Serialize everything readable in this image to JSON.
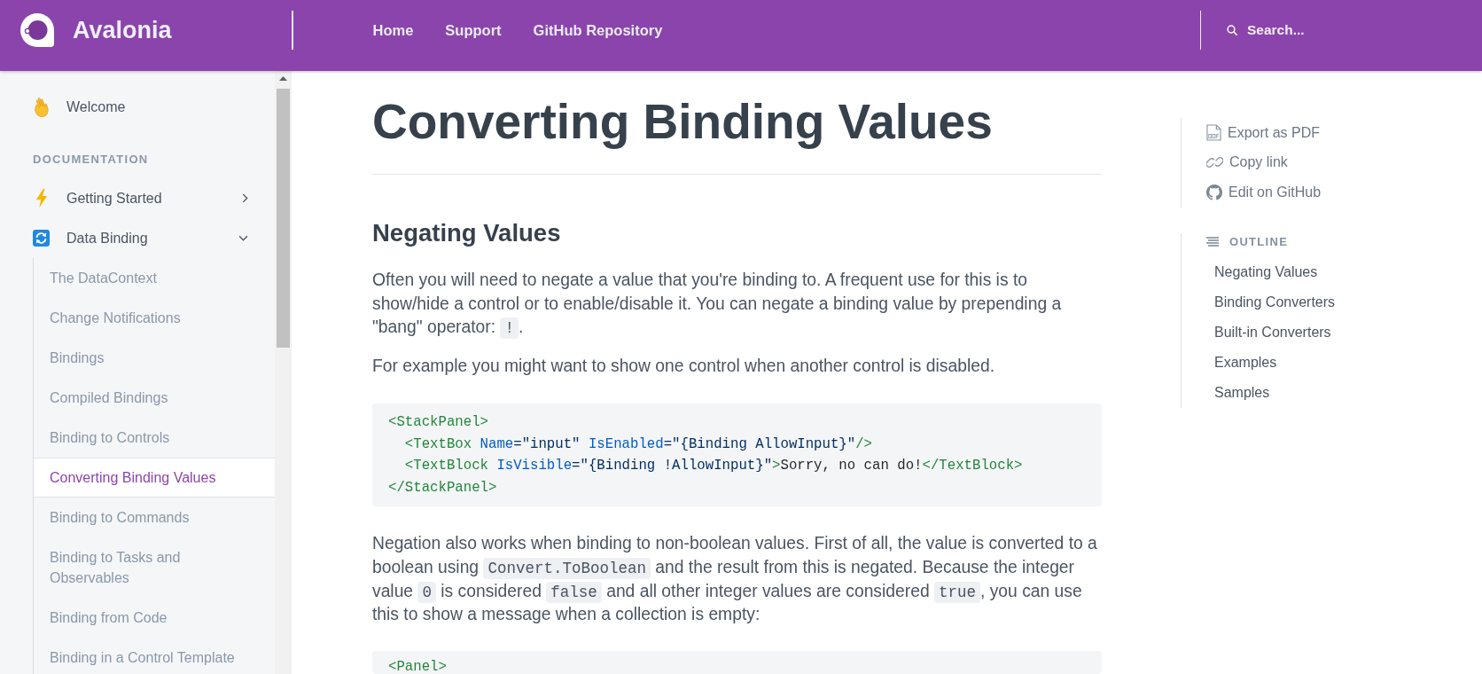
{
  "header": {
    "brand": "Avalonia",
    "nav": [
      "Home",
      "Support",
      "GitHub Repository"
    ],
    "search": {
      "placeholder": "Search..."
    }
  },
  "sidebar": {
    "items": [
      {
        "label": "Welcome",
        "selected": false
      }
    ],
    "sections": [
      {
        "heading": "DOCUMENTATION",
        "items": [
          {
            "label": "Getting Started",
            "selected": false,
            "expanded": false
          },
          {
            "label": "Data Binding",
            "selected": false,
            "expanded": true,
            "children": [
              {
                "label": "The DataContext",
                "selected": false
              },
              {
                "label": "Change Notifications",
                "selected": false
              },
              {
                "label": "Bindings",
                "selected": false
              },
              {
                "label": "Compiled Bindings",
                "selected": false
              },
              {
                "label": "Binding to Controls",
                "selected": false
              },
              {
                "label": "Converting Binding Values",
                "selected": true
              },
              {
                "label": "Binding to Commands",
                "selected": false
              },
              {
                "label": "Binding to Tasks and Observables",
                "selected": false
              },
              {
                "label": "Binding from Code",
                "selected": false
              },
              {
                "label": "Binding in a Control Template",
                "selected": false
              }
            ]
          }
        ]
      }
    ]
  },
  "article": {
    "title": "Converting Binding Values",
    "sections": [
      {
        "heading": "Negating Values",
        "blocks": [
          {
            "kind": "paragraph",
            "parts": [
              {
                "kind": "text",
                "text": "Often you will need to negate a value that you're binding to. A frequent use for this is to show/hide a control or to enable/disable it. You can negate a binding value by prepending a \"bang\" operator: "
              },
              {
                "kind": "code",
                "text": "!"
              },
              {
                "kind": "text",
                "text": "."
              }
            ]
          },
          {
            "kind": "paragraph",
            "parts": [
              {
                "kind": "text",
                "text": "For example you might want to show one control when another control is disabled."
              }
            ]
          },
          {
            "kind": "code",
            "lines": [
              {
                "tokens": [
                  {
                    "kind": "tag",
                    "text": "<StackPanel>"
                  }
                ]
              },
              {
                "tokens": [
                  {
                    "kind": "tag",
                    "text": "  <TextBox"
                  },
                  {
                    "kind": "attr",
                    "text": " Name"
                  },
                  {
                    "kind": "string",
                    "text": "=\"input\""
                  },
                  {
                    "kind": "attr",
                    "text": " IsEnabled"
                  },
                  {
                    "kind": "string",
                    "text": "=\"{Binding AllowInput}\""
                  },
                  {
                    "kind": "tag",
                    "text": "/>"
                  }
                ]
              },
              {
                "tokens": [
                  {
                    "kind": "tag",
                    "text": "  <TextBlock"
                  },
                  {
                    "kind": "attr",
                    "text": " IsVisible"
                  },
                  {
                    "kind": "string",
                    "text": "=\"{Binding !AllowInput}\""
                  },
                  {
                    "kind": "tag",
                    "text": ">"
                  },
                  {
                    "kind": "text",
                    "text": "Sorry, no can do!"
                  },
                  {
                    "kind": "tag",
                    "text": "</TextBlock>"
                  }
                ]
              },
              {
                "tokens": [
                  {
                    "kind": "tag",
                    "text": "</StackPanel>"
                  }
                ]
              }
            ]
          },
          {
            "kind": "paragraph",
            "parts": [
              {
                "kind": "text",
                "text": "Negation also works when binding to non-boolean values. First of all, the value is converted to a boolean using "
              },
              {
                "kind": "code",
                "text": "Convert.ToBoolean"
              },
              {
                "kind": "text",
                "text": " and the result from this is negated. Because the integer value "
              },
              {
                "kind": "code",
                "text": "0"
              },
              {
                "kind": "text",
                "text": " is considered "
              },
              {
                "kind": "code",
                "text": "false"
              },
              {
                "kind": "text",
                "text": " and all other integer values are considered "
              },
              {
                "kind": "code",
                "text": "true"
              },
              {
                "kind": "text",
                "text": ", you can use this to show a message when a collection is empty:"
              }
            ]
          },
          {
            "kind": "code",
            "lines": [
              {
                "tokens": [
                  {
                    "kind": "tag",
                    "text": "<Panel>"
                  }
                ]
              }
            ]
          }
        ]
      }
    ]
  },
  "page_actions": [
    "Export as PDF",
    "Copy link",
    "Edit on GitHub"
  ],
  "outline": {
    "heading": "OUTLINE",
    "items": [
      "Negating Values",
      "Binding Converters",
      "Built-in Converters",
      "Examples",
      "Samples"
    ]
  }
}
